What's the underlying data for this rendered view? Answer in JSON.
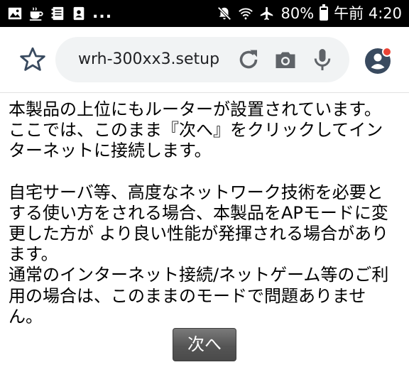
{
  "status_bar": {
    "overflow_indicator": "...",
    "battery_text": "80%",
    "time": "午前 4:20",
    "left_icons": [
      "image-icon",
      "cup-icon",
      "notebook-icon",
      "contact-card-icon"
    ],
    "right_icons": [
      "mute-icon",
      "wifi-question-icon",
      "airplane-icon",
      "battery-icon"
    ],
    "battery_level": 0.8
  },
  "toolbar": {
    "url": "wrh-300xx3.setup",
    "icons": [
      "bookmark-star-icon",
      "reload-icon",
      "camera-icon",
      "microphone-icon",
      "account-avatar-icon"
    ],
    "accent_color": "#ea4335",
    "icon_color": "#5f6368",
    "avatar_color": "#394a5f"
  },
  "content": {
    "paragraph1": "本製品の上位にもルーターが設置されています。\nここでは、このまま『次へ』をクリックしてイン\nターネットに接続します。",
    "paragraph2": "自宅サーバ等、高度なネットワーク技術を必要と\nする使い方をされる場合、本製品をAPモードに変\n更した方が より良い性能が発揮される場合があり\nます。\n通常のインターネット接続/ネットゲーム等のご利\n用の場合は、このままのモードで問題ありませ\nん。",
    "next_button_label": "次へ"
  }
}
